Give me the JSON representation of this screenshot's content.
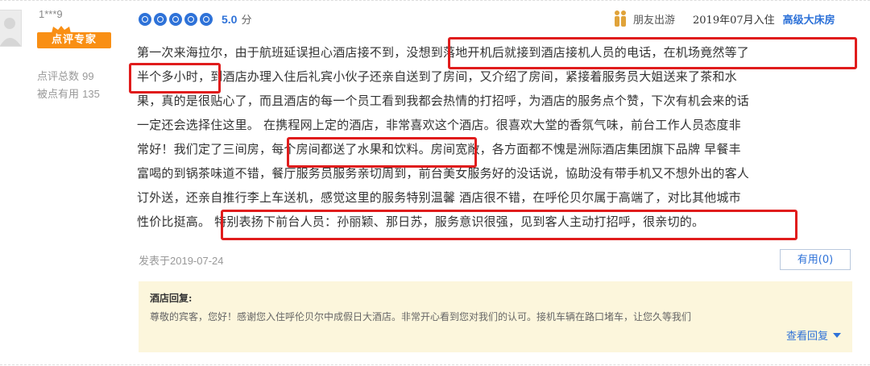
{
  "user": {
    "name": "1***9",
    "badge": "点评专家",
    "review_count_label": "点评总数",
    "review_count": "99",
    "helpful_label": "被点有用",
    "helpful_count": "135"
  },
  "rating": {
    "score": "5.0",
    "unit": "分",
    "dots": 5
  },
  "trip": {
    "type": "朋友出游",
    "checkin": "2019年07月入住",
    "room": "高级大床房"
  },
  "review": {
    "lines": [
      "第一次来海拉尔，由于航班延误担心酒店接不到，没想到落地开机后就接到酒店接机人员的电话，在机场竟然等了",
      "半个多小时，到酒店办理入住后礼宾小伙子还亲自送到了房间，又介绍了房间，紧接着服务员大姐送来了茶和水",
      "果，真的是很贴心了，而且酒店的每一个员工看到我都会热情的打招呼，为酒店的服务点个赞，下次有机会来的话",
      "一定还会选择住这里。 在携程网上定的酒店，非常喜欢这个酒店。很喜欢大堂的香氛气味，前台工作人员态度非",
      "常好！我们定了三间房，每个房间都送了水果和饮料。房间宽敞，各方面都不愧是洲际酒店集团旗下品牌 早餐丰",
      "富喝的到锅茶味道不错，餐厅服务员服务亲切周到，前台美女服务好的没话说，協助没有带手机又不想外出的客人",
      "订外送，还亲自推行李上车送机，感觉这里的服务特别温馨 酒店很不错，在呼伦贝尔属于高端了，对比其他城市",
      "性价比挺高。 特别表扬下前台人员：孙丽颖、那日苏，服务意识很强，见到客人主动打招呼，很亲切的。"
    ]
  },
  "posted": {
    "label": "发表于",
    "date": "2019-07-24"
  },
  "useful_button": "有用(0)",
  "reply": {
    "title": "酒店回复:",
    "text": "尊敬的宾客，您好！感谢您入住呼伦贝尔中成假日大酒店。非常开心看到您对我们的认可。接机车辆在路口堵车，让您久等我们",
    "more": "查看回复"
  },
  "colors": {
    "accent": "#2e72d8",
    "badge": "#f98f14",
    "highlight": "#e01c1c",
    "reply_bg": "#fcf6dc"
  }
}
